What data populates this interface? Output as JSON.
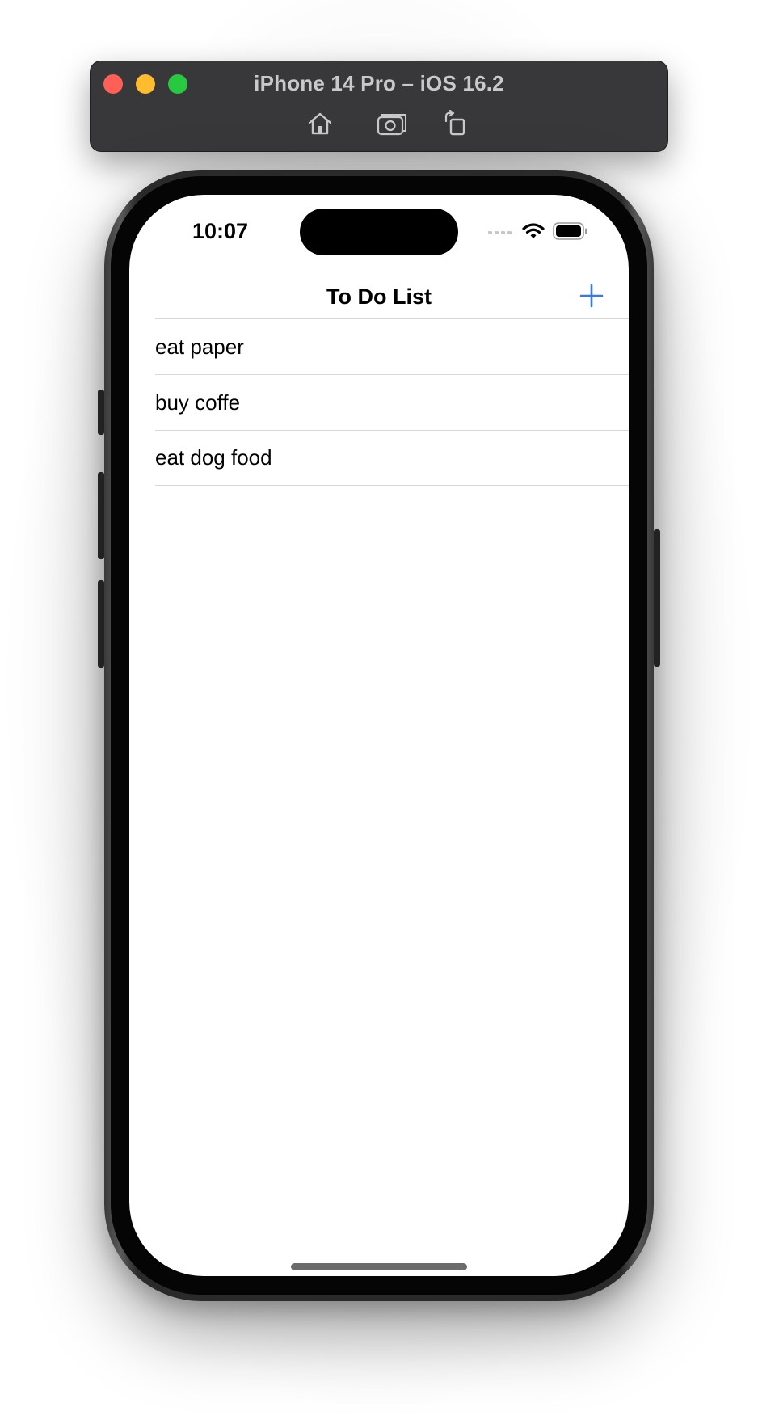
{
  "simulator": {
    "title": "iPhone 14 Pro – iOS 16.2",
    "toolbar_buttons": [
      "home-icon",
      "screenshot-icon",
      "rotate-icon"
    ]
  },
  "status_bar": {
    "time": "10:07",
    "icons": [
      "cellular-icon",
      "wifi-icon",
      "battery-icon"
    ]
  },
  "nav_bar": {
    "title": "To Do List",
    "add_icon": "plus-icon",
    "accent_color": "#3478f6"
  },
  "todo_items": [
    {
      "label": "eat paper"
    },
    {
      "label": "buy coffe"
    },
    {
      "label": "eat dog food"
    }
  ]
}
